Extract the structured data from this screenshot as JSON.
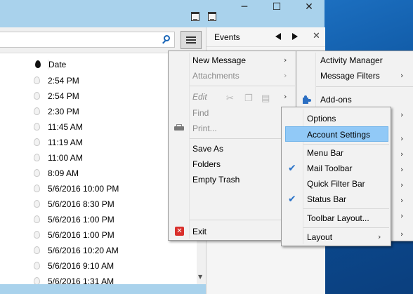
{
  "window": {
    "today_pane_title": "Events",
    "icons": [
      "calendar-icon",
      "tasks-icon"
    ]
  },
  "message_list": {
    "column_date": "Date",
    "rows": [
      "2:54 PM",
      "2:54 PM",
      "2:30 PM",
      "11:45 AM",
      "11:19 AM",
      "11:00 AM",
      "8:09 AM",
      "5/6/2016 10:00 PM",
      "5/6/2016 8:30 PM",
      "5/6/2016 1:00 PM",
      "5/6/2016 1:00 PM",
      "5/6/2016 10:20 AM",
      "5/6/2016 9:10 AM",
      "5/6/2016 1:31 AM"
    ]
  },
  "app_menu": {
    "new_message": "New Message",
    "attachments": "Attachments",
    "edit": "Edit",
    "find": "Find",
    "print": "Print...",
    "save_as": "Save As",
    "folders": "Folders",
    "empty_trash": "Empty Trash",
    "exit": "Exit"
  },
  "tools_menu": {
    "activity_manager": "Activity Manager",
    "message_filters": "Message Filters",
    "addons": "Add-ons"
  },
  "prefs_menu": {
    "options": "Options",
    "account_settings": "Account Settings",
    "menu_bar": "Menu Bar",
    "mail_toolbar": "Mail Toolbar",
    "quick_filter_bar": "Quick Filter Bar",
    "status_bar": "Status Bar",
    "toolbar_layout": "Toolbar Layout...",
    "layout": "Layout",
    "checked": [
      "Mail Toolbar",
      "Status Bar"
    ]
  },
  "colors": {
    "titlebar": "#a9d2ec",
    "highlight": "#91c9f7",
    "check": "#2a73c9"
  }
}
